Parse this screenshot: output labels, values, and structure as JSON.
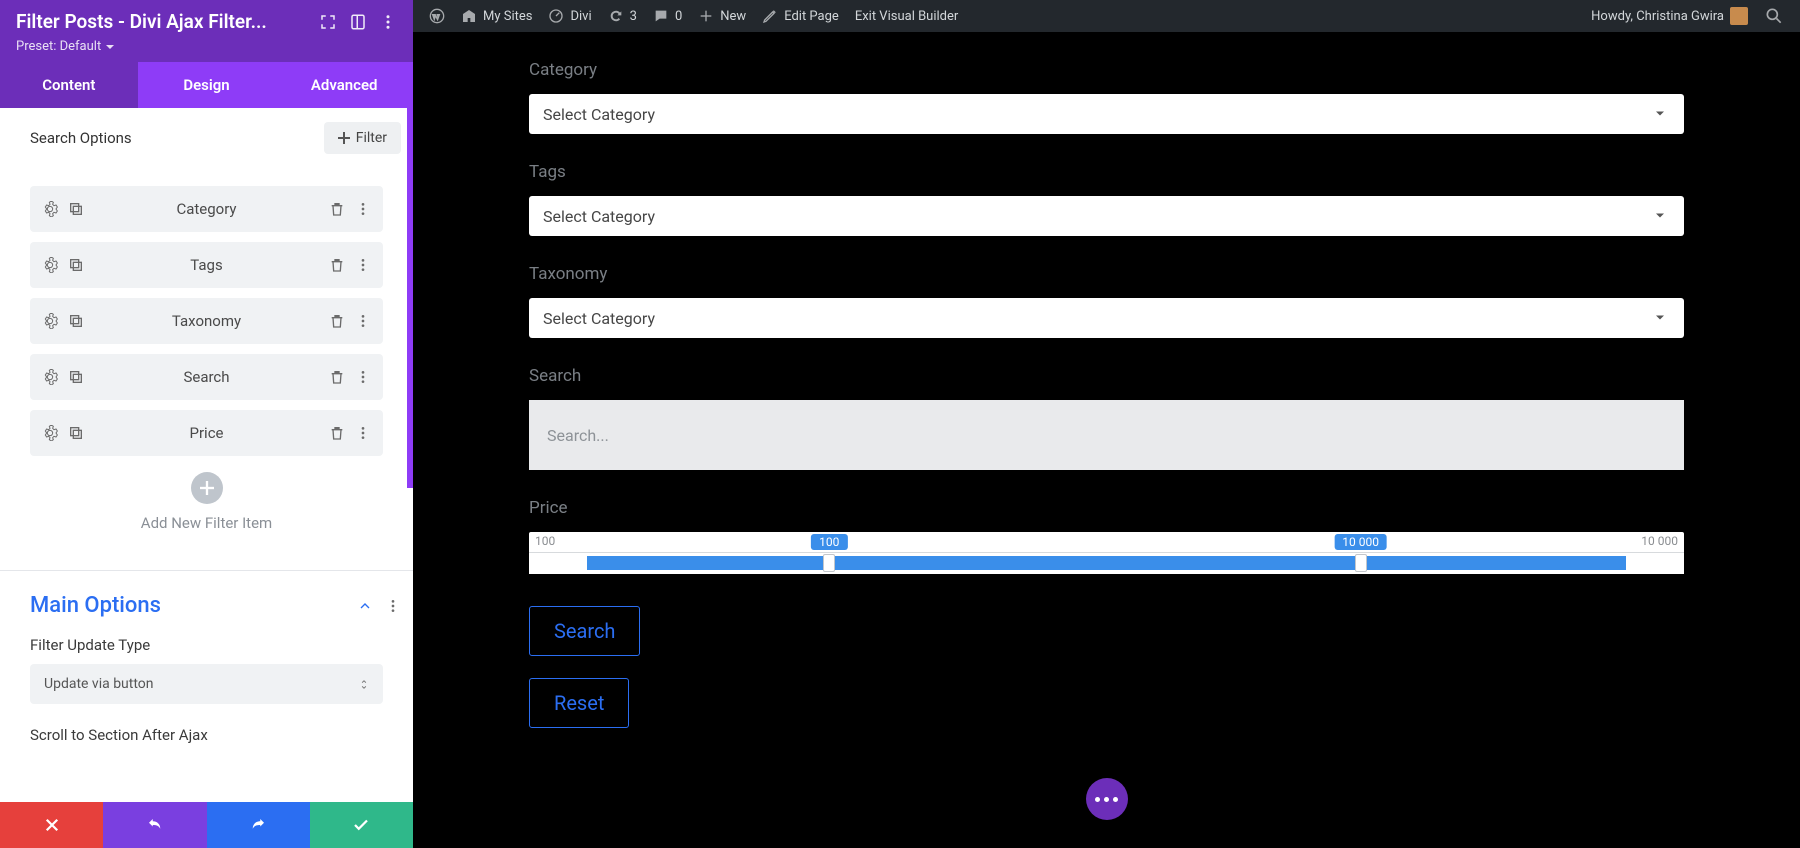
{
  "sidebar": {
    "module_title": "Filter Posts - Divi Ajax Filter...",
    "preset_label": "Preset: Default",
    "tabs": {
      "content": "Content",
      "design": "Design",
      "advanced": "Advanced"
    },
    "search_options_label": "Search Options",
    "add_filter_label": "Filter",
    "items": [
      {
        "label": "Category"
      },
      {
        "label": "Tags"
      },
      {
        "label": "Taxonomy"
      },
      {
        "label": "Search"
      },
      {
        "label": "Price"
      }
    ],
    "add_new_label": "Add New Filter Item",
    "main_options_title": "Main Options",
    "filter_update_type_label": "Filter Update Type",
    "filter_update_type_value": "Update via button",
    "scroll_label": "Scroll to Section After Ajax"
  },
  "adminbar": {
    "my_sites": "My Sites",
    "divi": "Divi",
    "refresh_count": "3",
    "comments_count": "0",
    "new": "New",
    "edit_page": "Edit Page",
    "exit_builder": "Exit Visual Builder",
    "howdy": "Howdy, Christina Gwira"
  },
  "preview": {
    "category_label": "Category",
    "tags_label": "Tags",
    "taxonomy_label": "Taxonomy",
    "search_label": "Search",
    "price_label": "Price",
    "select_placeholder": "Select Category",
    "search_placeholder": "Search...",
    "price_min": "100",
    "price_max": "10 000",
    "bubble_low": "100",
    "bubble_high": "10 000",
    "search_btn": "Search",
    "reset_btn": "Reset"
  }
}
